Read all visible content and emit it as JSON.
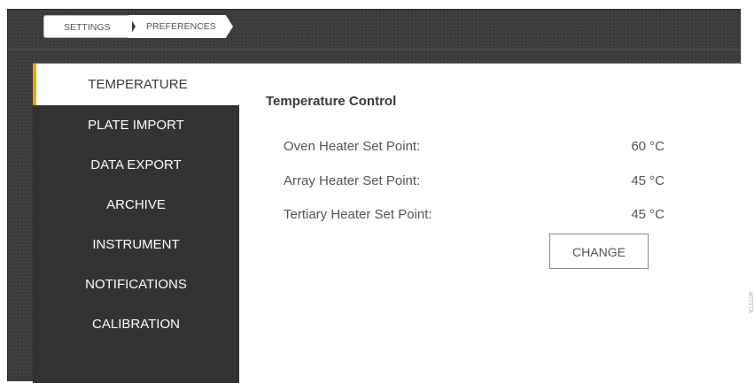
{
  "breadcrumb": {
    "items": [
      "SETTINGS",
      "PREFERENCES"
    ]
  },
  "sidebar": {
    "items": [
      {
        "label": "TEMPERATURE",
        "active": true
      },
      {
        "label": "PLATE IMPORT",
        "active": false
      },
      {
        "label": "DATA EXPORT",
        "active": false
      },
      {
        "label": "ARCHIVE",
        "active": false
      },
      {
        "label": "INSTRUMENT",
        "active": false
      },
      {
        "label": "NOTIFICATIONS",
        "active": false
      },
      {
        "label": "CALIBRATION",
        "active": false
      }
    ],
    "active_accent_color": "#f0a500"
  },
  "main": {
    "section_title": "Temperature Control",
    "settings": [
      {
        "label": "Oven Heater Set Point:",
        "value": "60 °C"
      },
      {
        "label": "Array Heater Set Point:",
        "value": "45 °C"
      },
      {
        "label": "Tertiary Heater Set Point:",
        "value": "45 °C"
      }
    ],
    "change_label": "CHANGE"
  },
  "watermark": "4075TA"
}
